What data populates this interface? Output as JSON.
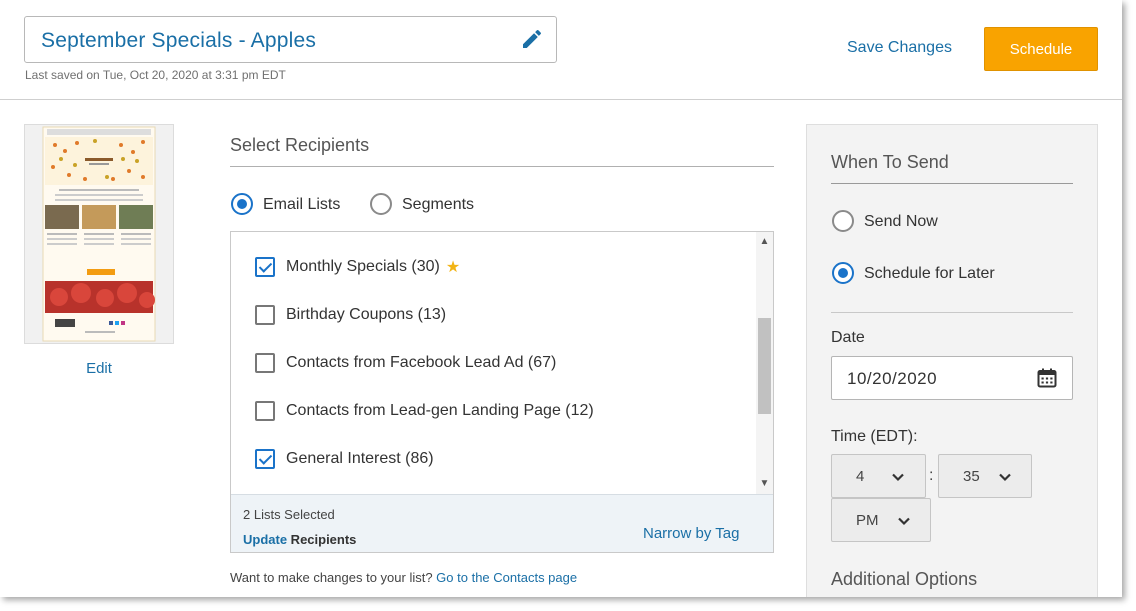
{
  "header": {
    "campaign_title": "September Specials - Apples",
    "last_saved": "Last saved on Tue, Oct 20, 2020 at 3:31 pm EDT",
    "save_changes_label": "Save Changes",
    "schedule_label": "Schedule"
  },
  "preview": {
    "edit_label": "Edit"
  },
  "recipients": {
    "title": "Select Recipients",
    "tabs": [
      {
        "label": "Email Lists",
        "selected": true
      },
      {
        "label": "Segments",
        "selected": false
      }
    ],
    "lists": [
      {
        "label": "Monthly Specials (30)",
        "checked": true,
        "starred": true
      },
      {
        "label": "Birthday Coupons (13)",
        "checked": false,
        "starred": false
      },
      {
        "label": "Contacts from Facebook Lead Ad (67)",
        "checked": false,
        "starred": false
      },
      {
        "label": "Contacts from Lead-gen Landing Page (12)",
        "checked": false,
        "starred": false
      },
      {
        "label": "General Interest (86)",
        "checked": true,
        "starred": false
      }
    ],
    "star_glyph": "★",
    "footer": {
      "selected_count": "2 Lists Selected",
      "update_word": "Update",
      "recipients_word": " Recipients",
      "narrow_by_tag": "Narrow by Tag"
    },
    "change_prompt": "Want to make changes to your list? ",
    "contacts_link": "Go to the Contacts page"
  },
  "when_to_send": {
    "title": "When To Send",
    "options": [
      {
        "label": "Send Now",
        "selected": false
      },
      {
        "label": "Schedule for Later",
        "selected": true
      }
    ],
    "date_label": "Date",
    "date_value": "10/20/2020",
    "time_label": "Time (EDT):",
    "hour": "4",
    "minute": "35",
    "ampm": "PM",
    "colon": ":",
    "additional_options": "Additional Options"
  },
  "colors": {
    "accent": "#1a6fa6",
    "primary_button": "#f9a300",
    "control_blue": "#1a73c9",
    "star": "#f2b416"
  }
}
